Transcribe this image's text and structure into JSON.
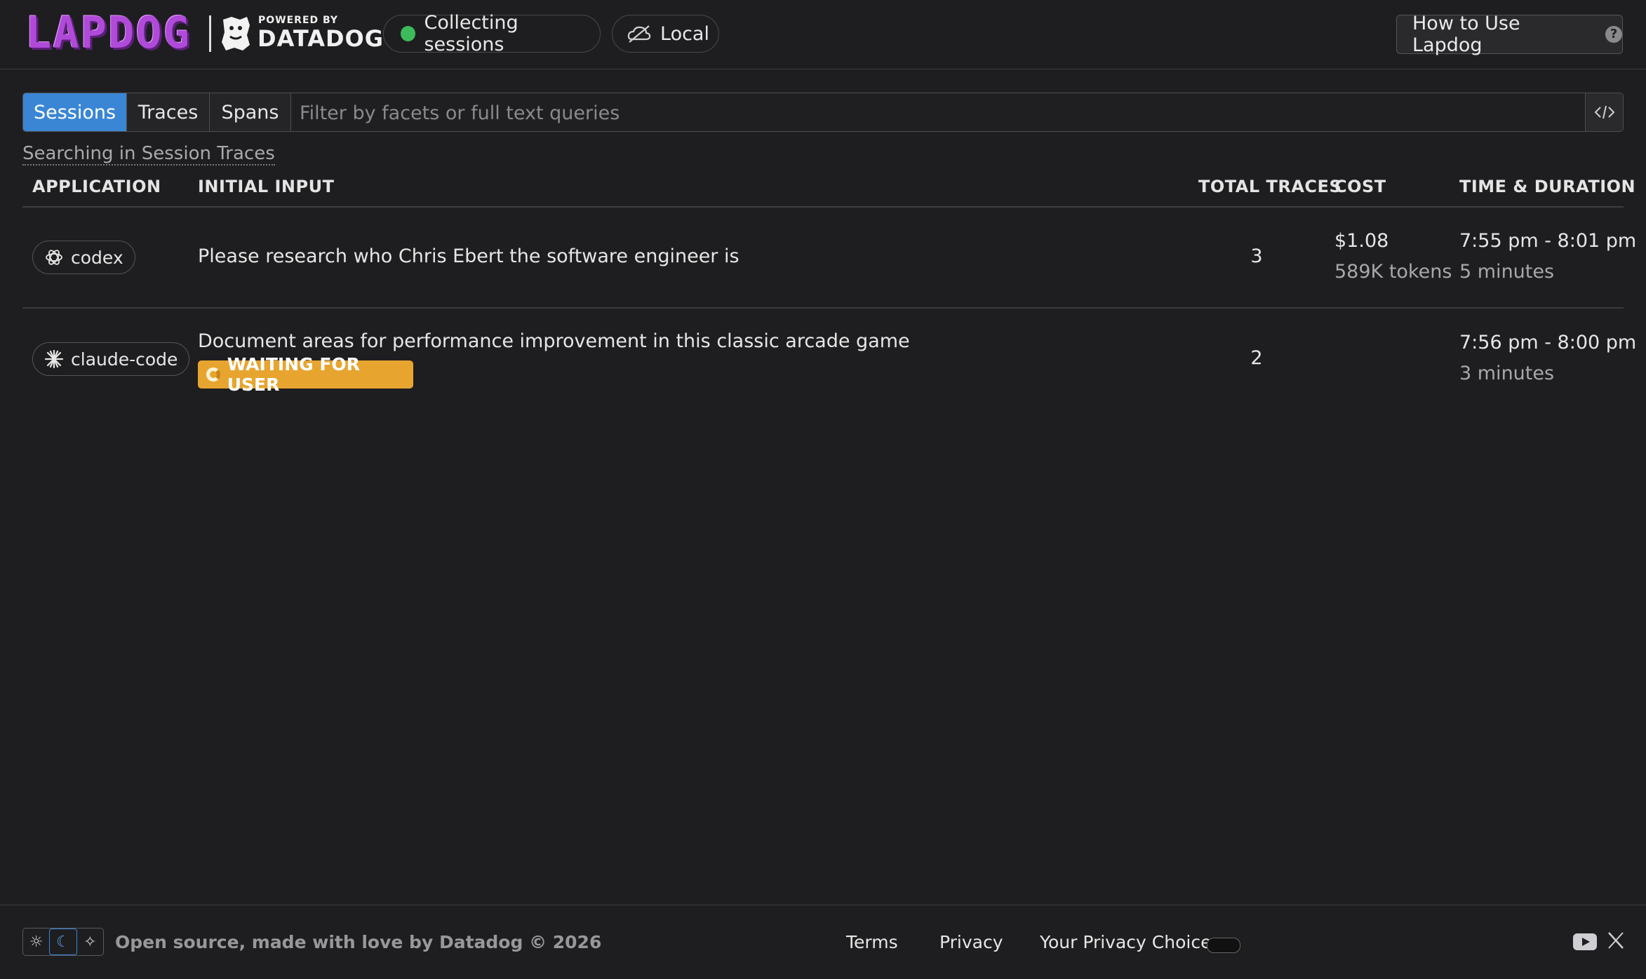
{
  "header": {
    "logo_text": "LAPDOG",
    "powered_by": "POWERED BY",
    "brand": "DATADOG",
    "status_label": "Collecting sessions",
    "status_color": "#3dbb5b",
    "env_label": "Local",
    "help_label": "How to Use Lapdog"
  },
  "search": {
    "tabs": [
      {
        "label": "Sessions",
        "active": true
      },
      {
        "label": "Traces",
        "active": false
      },
      {
        "label": "Spans",
        "active": false
      }
    ],
    "placeholder": "Filter by facets or full text queries",
    "scope_label": "Searching in Session Traces"
  },
  "table": {
    "columns": [
      "APPLICATION",
      "INITIAL INPUT",
      "TOTAL TRACES",
      "COST",
      "TIME & DURATION"
    ],
    "rows": [
      {
        "application": "codex",
        "app_icon": "openai-icon",
        "initial_input": "Please research who Chris Ebert the software engineer is",
        "total_traces": "3",
        "cost": "$1.08",
        "tokens": "589K tokens",
        "time": "7:55 pm - 8:01 pm",
        "duration": "5 minutes"
      },
      {
        "application": "claude-code",
        "app_icon": "claude-sparkle-icon",
        "initial_input": "Document areas for performance improvement in this classic arcade game",
        "status_badge": "WAITING FOR USER",
        "total_traces": "2",
        "time": "7:56 pm - 8:00 pm",
        "duration": "3 minutes"
      }
    ]
  },
  "footer": {
    "theme_options": [
      "sun-icon",
      "moon-icon",
      "wand-icon"
    ],
    "active_theme": "moon-icon",
    "credit": "Open source, made with love by Datadog © 2026",
    "links": [
      "Terms",
      "Privacy",
      "Your Privacy Choices"
    ]
  },
  "colors": {
    "background": "#1e1e20",
    "accent": "#3a86d4",
    "badge": "#e7a530",
    "logo": "#b04ad8"
  }
}
